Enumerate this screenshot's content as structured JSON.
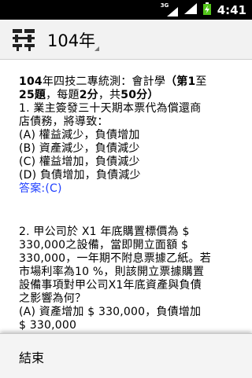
{
  "status_bar": {
    "network_type": "3G",
    "time": "4:41"
  },
  "action_bar": {
    "title": "104年"
  },
  "header": {
    "year": "104",
    "exam": "年四技二專統測：會計學",
    "paren_open": "（",
    "range_prefix": "第",
    "range_start": "1",
    "range_to": "至",
    "range_end": "25",
    "range_unit": "題",
    "comma1": "，每題",
    "points_each": "2",
    "points_unit": "分",
    "comma2": "，共",
    "total_points": "50",
    "points_unit2": "分",
    "paren_close": "）"
  },
  "questions": [
    {
      "lines": [
        "1. 業主簽發三十天期本票代為償還商",
        "店債務，將導致："
      ],
      "options": [
        "(A) 權益減少，負債增加",
        "(B) 資產減少，負債減少",
        "(C) 權益增加，負債減少",
        "(D) 負債增加，負債減少"
      ],
      "answer": "答案:(C)"
    },
    {
      "lines": [
        "2. 甲公司於 X1 年底購置標價為 $",
        "330,000之設備，當即開立面額 $",
        "330,000，一年期不附息票據乙紙。若",
        "市場利率為10 %，則該開立票據購置",
        "設備事項對甲公司X1年底資產與負債",
        "之影響為何？"
      ],
      "options": [
        "(A) 資產增加 $ 330,000，負債增加",
        "$ 330,000"
      ]
    }
  ],
  "menu": {
    "end_label": "結束"
  }
}
